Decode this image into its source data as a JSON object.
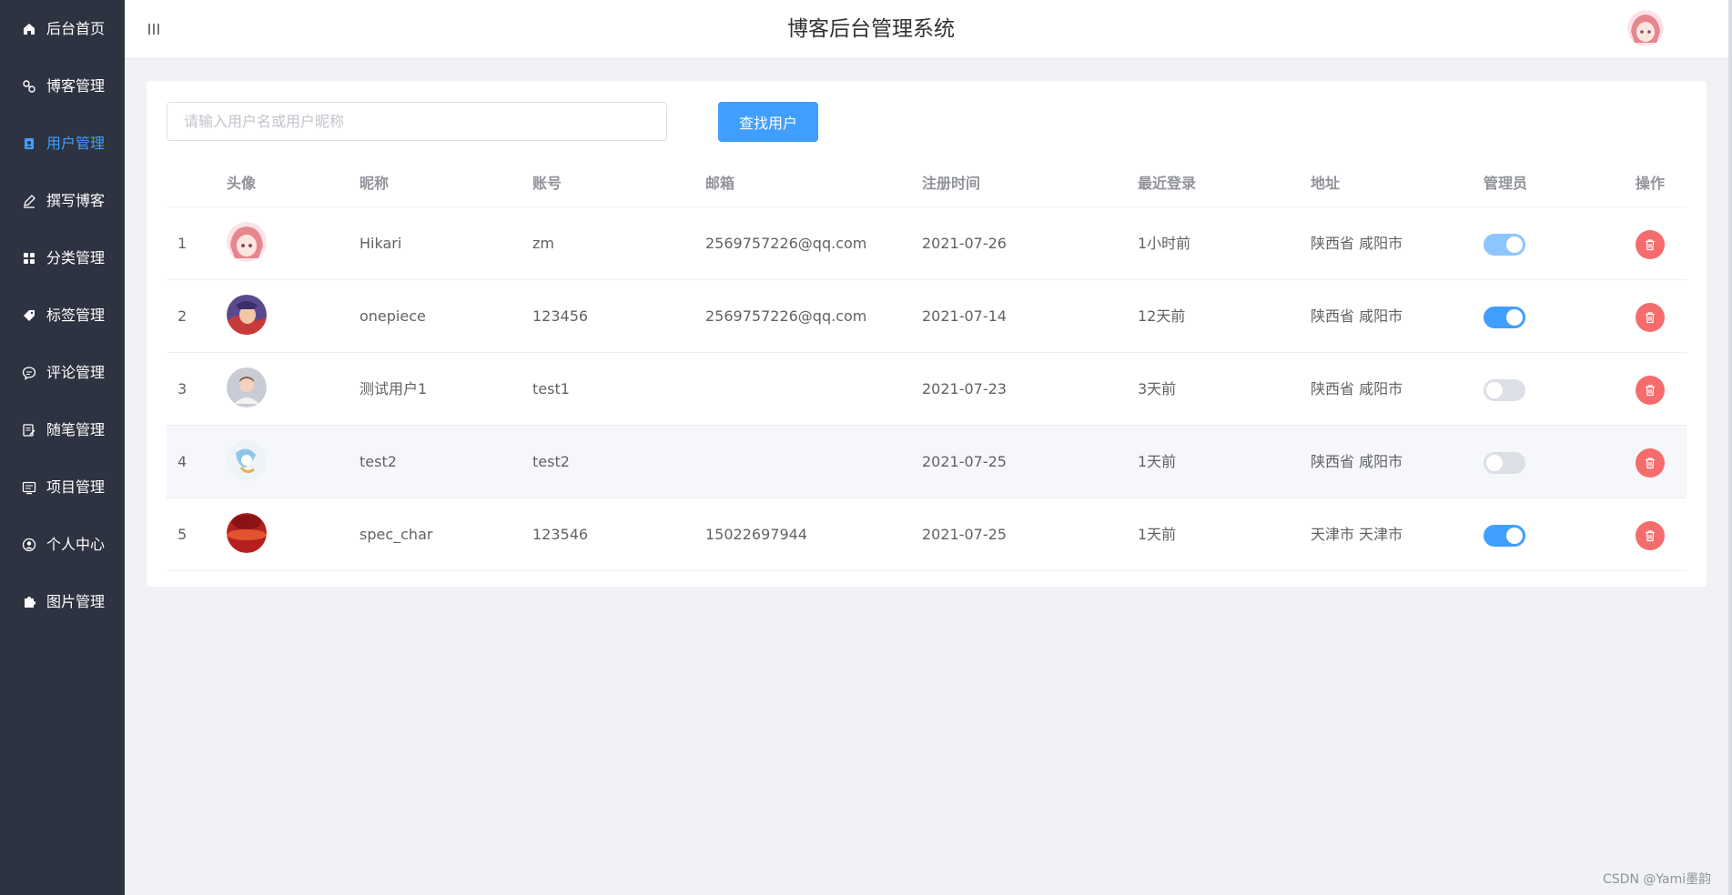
{
  "app": {
    "title": "博客后台管理系统"
  },
  "sidebar": {
    "items": [
      {
        "label": "后台首页",
        "icon": "home-icon"
      },
      {
        "label": "博客管理",
        "icon": "blog-icon"
      },
      {
        "label": "用户管理",
        "icon": "user-icon",
        "active": true
      },
      {
        "label": "撰写博客",
        "icon": "pen-icon"
      },
      {
        "label": "分类管理",
        "icon": "grid-icon"
      },
      {
        "label": "标签管理",
        "icon": "tag-icon"
      },
      {
        "label": "评论管理",
        "icon": "comment-icon"
      },
      {
        "label": "随笔管理",
        "icon": "note-icon"
      },
      {
        "label": "项目管理",
        "icon": "project-icon"
      },
      {
        "label": "个人中心",
        "icon": "profile-icon"
      },
      {
        "label": "图片管理",
        "icon": "puzzle-icon"
      }
    ]
  },
  "search": {
    "placeholder": "请输入用户名或用户昵称",
    "value": "",
    "button_label": "查找用户"
  },
  "table": {
    "headers": {
      "avatar": "头像",
      "nickname": "昵称",
      "account": "账号",
      "email": "邮箱",
      "register_time": "注册时间",
      "last_login": "最近登录",
      "address": "地址",
      "admin": "管理员",
      "actions": "操作"
    },
    "rows": [
      {
        "index": "1",
        "nickname": "Hikari",
        "account": "zm",
        "email": "2569757226@qq.com",
        "register_time": "2021-07-26",
        "last_login": "1小时前",
        "address": "陕西省 咸阳市",
        "admin": true
      },
      {
        "index": "2",
        "nickname": "onepiece",
        "account": "123456",
        "email": "2569757226@qq.com",
        "register_time": "2021-07-14",
        "last_login": "12天前",
        "address": "陕西省 咸阳市",
        "admin": true
      },
      {
        "index": "3",
        "nickname": "测试用户1",
        "account": "test1",
        "email": "",
        "register_time": "2021-07-23",
        "last_login": "3天前",
        "address": "陕西省 咸阳市",
        "admin": false
      },
      {
        "index": "4",
        "nickname": "test2",
        "account": "test2",
        "email": "",
        "register_time": "2021-07-25",
        "last_login": "1天前",
        "address": "陕西省 咸阳市",
        "admin": false
      },
      {
        "index": "5",
        "nickname": "spec_char",
        "account": "123546",
        "email": "15022697944",
        "register_time": "2021-07-25",
        "last_login": "1天前",
        "address": "天津市 天津市",
        "admin": true
      }
    ]
  },
  "watermark": "CSDN @Yami墨韵",
  "colors": {
    "sidebar_bg": "#2e3341",
    "accent": "#409eff",
    "danger": "#f56c6c",
    "page_bg": "#f0f2f5"
  }
}
